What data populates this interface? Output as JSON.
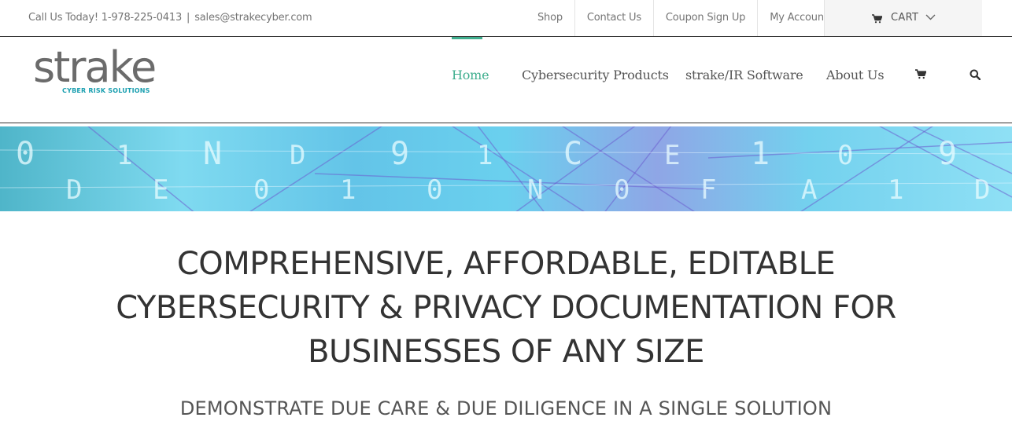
{
  "topbar": {
    "phone": "Call Us Today! 1-978-225-0413",
    "separator": "|",
    "email": "sales@strakecyber.com",
    "menu": [
      "Shop",
      "Contact Us",
      "Coupon Sign Up",
      "My Account"
    ],
    "cart_label": "CART"
  },
  "logo": {
    "word": "strake",
    "tagline": "CYBER RISK SOLUTIONS"
  },
  "nav": {
    "items": [
      "Home",
      "Cybersecurity Products",
      "strake/IR Software",
      "About Us"
    ],
    "active": "Home",
    "active_color": "#3fae8e"
  },
  "banner": {
    "glyphs": [
      "0",
      "D",
      "1",
      "E",
      "N",
      "0",
      "D",
      "1",
      "9",
      "0",
      "1",
      "N",
      "C",
      "0",
      "E",
      "F",
      "1",
      "A",
      "0",
      "1",
      "9",
      "D"
    ]
  },
  "hero": {
    "line1": "COMPREHENSIVE, AFFORDABLE, EDITABLE",
    "line2": "CYBERSECURITY & PRIVACY DOCUMENTATION FOR",
    "line3": "BUSINESSES OF ANY SIZE",
    "subtitle": "DEMONSTRATE DUE CARE & DUE DILIGENCE IN A SINGLE SOLUTION"
  }
}
